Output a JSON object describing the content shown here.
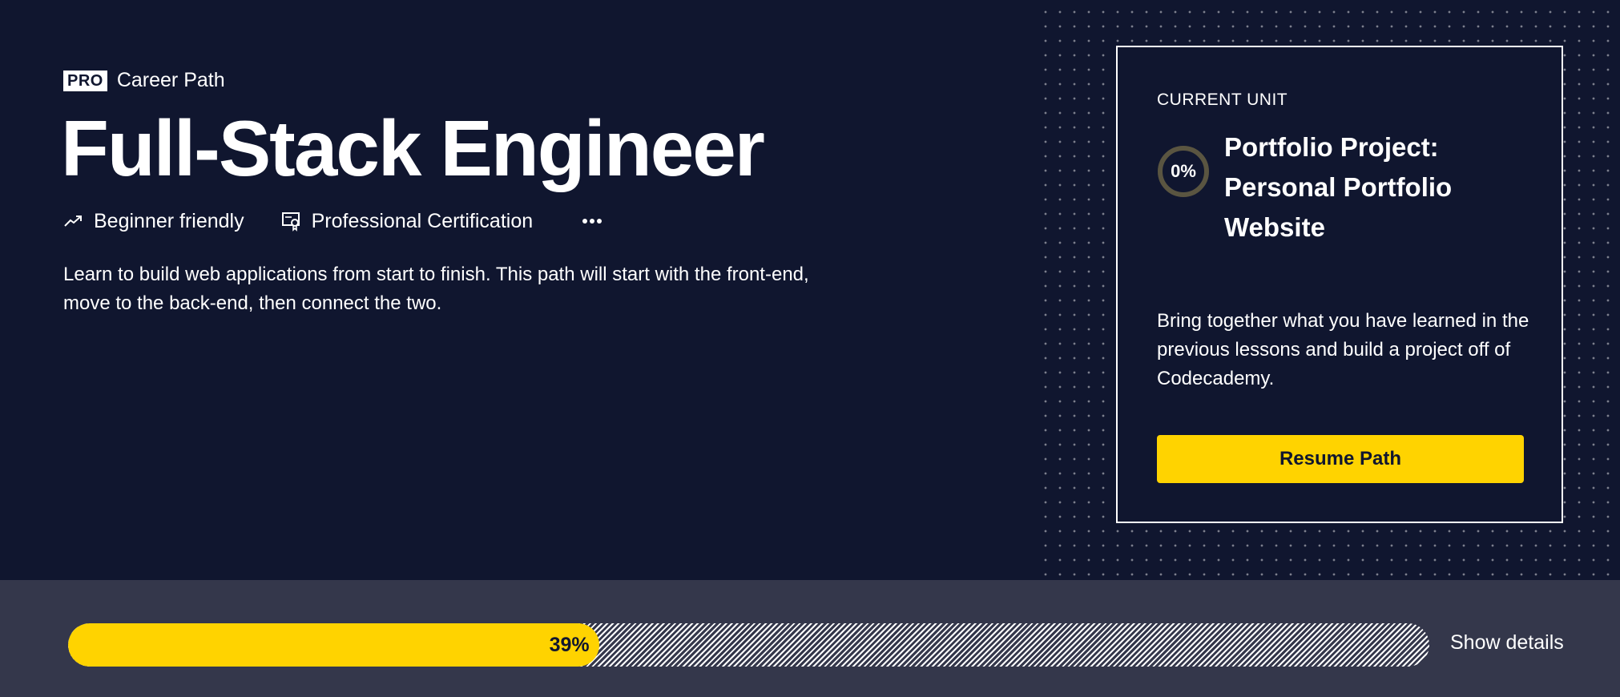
{
  "colors": {
    "background": "#10162f",
    "accent": "#ffd300",
    "progress_bar_bg": "#34374b",
    "text": "#ffffff"
  },
  "header": {
    "badge": "PRO",
    "eyebrow": "Career Path",
    "title": "Full-Stack Engineer",
    "meta": [
      {
        "icon": "trend-up-icon",
        "label": "Beginner friendly"
      },
      {
        "icon": "certificate-icon",
        "label": "Professional Certification"
      }
    ],
    "more_icon": "more-dots-icon",
    "description": "Learn to build web applications from start to finish. This path will start with the front-end, move to the back-end, then connect the two."
  },
  "current_unit": {
    "kicker": "CURRENT UNIT",
    "progress_percent": 0,
    "progress_label": "0%",
    "title": "Portfolio Project: Personal Portfolio Website",
    "description": "Bring together what you have learned in the previous lessons and build a project off of Codecademy.",
    "button": "Resume Path"
  },
  "path_progress": {
    "percent": 39,
    "label": "39%",
    "details_link": "Show details"
  }
}
